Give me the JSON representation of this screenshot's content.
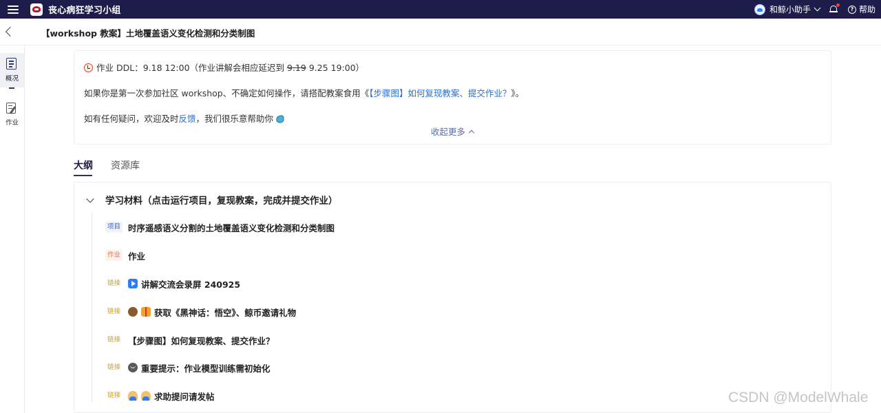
{
  "topbar": {
    "brand": "丧心病狂学习小组",
    "user_name": "和鲸小助手",
    "help_label": "帮助"
  },
  "header": {
    "title": "【workshop 教案】土地覆盖语义变化检测和分类制图"
  },
  "rail": {
    "items": [
      {
        "label": "概况",
        "active": true
      },
      {
        "label": "作业",
        "active": false
      }
    ]
  },
  "notice": {
    "ddl_prefix": "作业 DDL：9.18 12:00（作业讲解会相应延迟到 ",
    "ddl_old": "9.19",
    "ddl_new": " 9.25 19:00）",
    "intro_prefix": "如果你是第一次参加社区 workshop、不确定如何操作，请搭配教案食用《",
    "intro_link": "【步骤图】如何复现教案、提交作业？",
    "intro_suffix": "》。",
    "help_prefix": "如有任何疑问，欢迎及时",
    "help_link": "反馈",
    "help_suffix": "，我们很乐意帮助你",
    "collapse_label": "收起更多"
  },
  "tabs": [
    {
      "label": "大纲",
      "active": true
    },
    {
      "label": "资源库",
      "active": false
    }
  ],
  "outline": {
    "section_title": "学习材料（点击运行项目，复现教案，完成并提交作业）",
    "items": [
      {
        "badge": "项目",
        "title": "时序遥感语义分割的土地覆盖语义变化检测和分类制图"
      },
      {
        "badge": "作业",
        "title": "作业"
      },
      {
        "badge": "链接",
        "title": "讲解交流会录屏 240925"
      },
      {
        "badge": "链接",
        "title": "获取《黑神话：悟空》、鲸币邀请礼物"
      },
      {
        "badge": "链接",
        "title": "【步骤图】如何复现教案、提交作业？"
      },
      {
        "badge": "链接",
        "title": "重要提示：作业模型训练需初始化"
      },
      {
        "badge": "链接",
        "title": "求助提问请发帖"
      }
    ]
  },
  "watermark": "CSDN @ModelWhale",
  "colors": {
    "nav_bg": "#1d1c4a",
    "link": "#2a6fd6",
    "badge_project": "#3a66c4",
    "badge_homework": "#e0744c",
    "badge_link": "#c8a030"
  }
}
